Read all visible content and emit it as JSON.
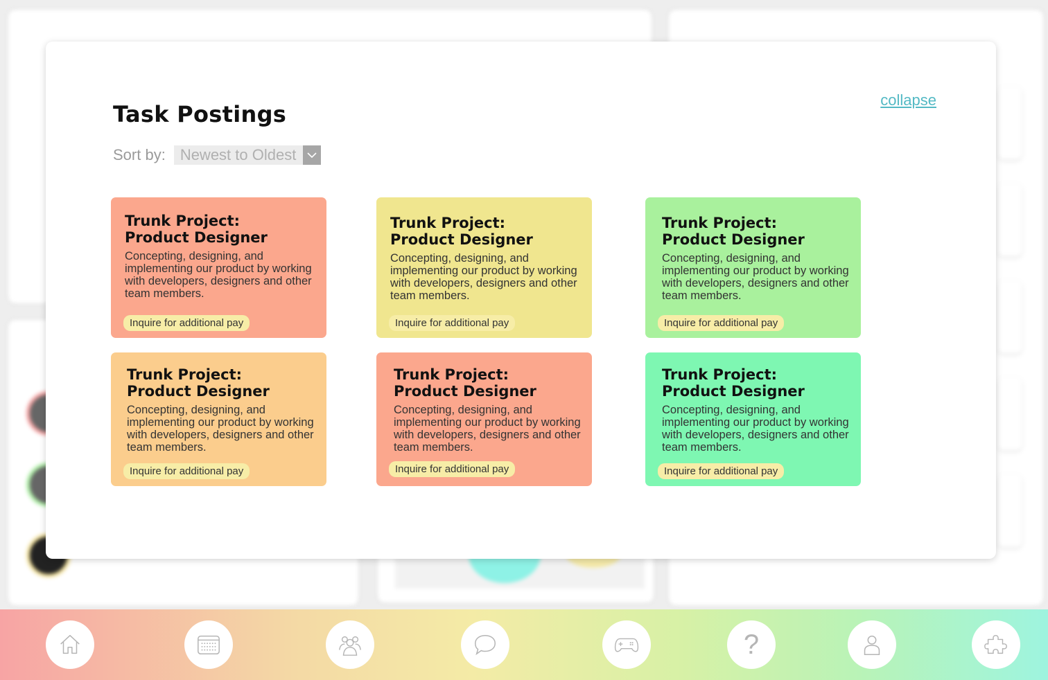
{
  "modal": {
    "title": "Task Postings",
    "collapse_label": "collapse",
    "sort": {
      "label": "Sort by:",
      "selected": "Newest to Oldest"
    }
  },
  "tasks": [
    {
      "title_line1": "Trunk Project:",
      "title_line2": "Product Designer",
      "description": "Concepting, designing, and implementing our product by working with developers, designers and other team members.",
      "badge": "Inquire for additional pay",
      "color": "#fba78d"
    },
    {
      "title_line1": "Trunk Project:",
      "title_line2": "Product Designer",
      "description": "Concepting, designing, and implementing our product by working with developers, designers and other team members.",
      "badge": "Inquire for additional pay",
      "color": "#f0e68f"
    },
    {
      "title_line1": "Trunk Project:",
      "title_line2": "Product Designer",
      "description": "Concepting, designing, and implementing our product by working with developers, designers and other team members.",
      "badge": "Inquire for additional pay",
      "color": "#a9f19d"
    },
    {
      "title_line1": "Trunk Project:",
      "title_line2": "Product Designer",
      "description": "Concepting, designing, and implementing our product by working with developers, designers and other team members.",
      "badge": "Inquire for additional pay",
      "color": "#fbcd8d"
    },
    {
      "title_line1": "Trunk Project:",
      "title_line2": "Product Designer",
      "description": "Concepting, designing, and implementing our product by working with developers, designers and other team members.",
      "badge": "Inquire for additional pay",
      "color": "#fba78d"
    },
    {
      "title_line1": "Trunk Project:",
      "title_line2": "Product Designer",
      "description": "Concepting, designing, and implementing our product by working with developers, designers and other team members.",
      "badge": "Inquire for additional pay",
      "color": "#7ef7b2"
    }
  ],
  "nav": {
    "items": [
      {
        "icon": "home-icon"
      },
      {
        "icon": "calendar-icon"
      },
      {
        "icon": "team-icon"
      },
      {
        "icon": "chat-icon"
      },
      {
        "icon": "gamepad-icon"
      },
      {
        "icon": "help-icon"
      },
      {
        "icon": "profile-icon"
      },
      {
        "icon": "puzzle-icon"
      }
    ],
    "help_glyph": "?"
  },
  "colors": {
    "accent_link": "#53b9c4",
    "badge_bg": "#f7eda7"
  }
}
